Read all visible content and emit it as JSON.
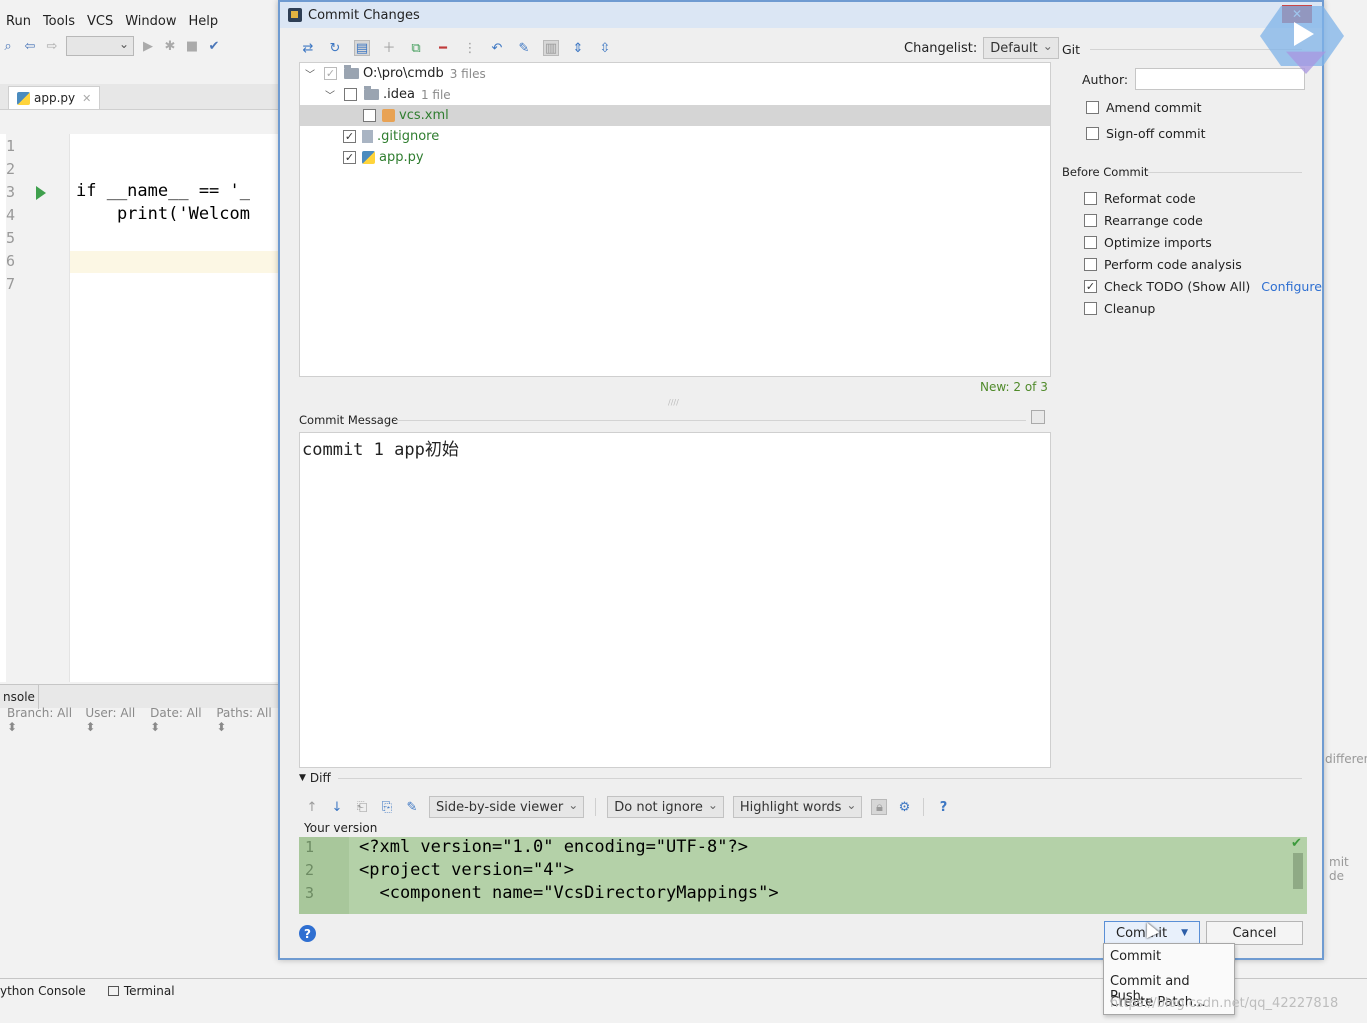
{
  "ide": {
    "menu": [
      "Run",
      "Tools",
      "VCS",
      "Window",
      "Help"
    ],
    "editor_tab": "app.py",
    "line_numbers": [
      "1",
      "2",
      "3",
      "4",
      "5",
      "6",
      "7"
    ],
    "code_lines": [
      "",
      "",
      "if __name__ == '_",
      "    print('Welcom",
      "",
      "",
      ""
    ],
    "bottom_tab": "nsole",
    "log_filters": [
      "Branch: All ⬍",
      "User: All ⬍",
      "Date: All ⬍",
      "Paths: All ⬍"
    ],
    "status_tabs": [
      "ython Console",
      "Terminal"
    ],
    "right_fragments": [
      "differen",
      "mit de"
    ]
  },
  "dialog": {
    "title": "Commit Changes",
    "changelist_label": "Changelist:",
    "changelist_value": "Default",
    "tree": [
      {
        "name": "O:\\pro\\cmdb",
        "count": "3 files",
        "level": 0,
        "checked": true,
        "dim": true,
        "icon": "folder-icon"
      },
      {
        "name": ".idea",
        "count": "1 file",
        "level": 1,
        "checked": false,
        "icon": "folder-icon"
      },
      {
        "name": "vcs.xml",
        "count": "",
        "level": 2,
        "checked": false,
        "icon": "xml-file-icon",
        "selected": true
      },
      {
        "name": ".gitignore",
        "count": "",
        "level": 1,
        "checked": true,
        "icon": "text-file-icon"
      },
      {
        "name": "app.py",
        "count": "",
        "level": 1,
        "checked": true,
        "icon": "python-file-icon"
      }
    ],
    "new_count": "New: 2 of 3",
    "commit_message_label": "Commit Message",
    "commit_message": "commit 1 app初始",
    "git": {
      "section": "Git",
      "author_label": "Author:",
      "author_value": "",
      "amend": "Amend commit",
      "signoff": "Sign-off commit"
    },
    "before_commit": {
      "section": "Before Commit",
      "options": [
        {
          "label": "Reformat code",
          "checked": false
        },
        {
          "label": "Rearrange code",
          "checked": false
        },
        {
          "label": "Optimize imports",
          "checked": false
        },
        {
          "label": "Perform code analysis",
          "checked": false
        },
        {
          "label": "Check TODO (Show All)",
          "checked": true,
          "link": "Configure"
        },
        {
          "label": "Cleanup",
          "checked": false
        }
      ]
    },
    "diff": {
      "label": "Diff",
      "viewer": "Side-by-side viewer",
      "ignore": "Do not ignore",
      "highlight": "Highlight words",
      "your_version": "Your version",
      "lines": [
        {
          "n": "1",
          "text": "<?xml version=\"1.0\" encoding=\"UTF-8\"?>"
        },
        {
          "n": "2",
          "text": "<project version=\"4\">"
        },
        {
          "n": "3",
          "text": "  <component name=\"VcsDirectoryMappings\">"
        }
      ]
    },
    "buttons": {
      "commit": "Commit",
      "cancel": "Cancel",
      "help": "?"
    },
    "commit_menu": [
      "Commit",
      "Commit and Push...",
      "Create Patch..."
    ]
  },
  "watermark": "https://blog.csdn.net/qq_42227818"
}
